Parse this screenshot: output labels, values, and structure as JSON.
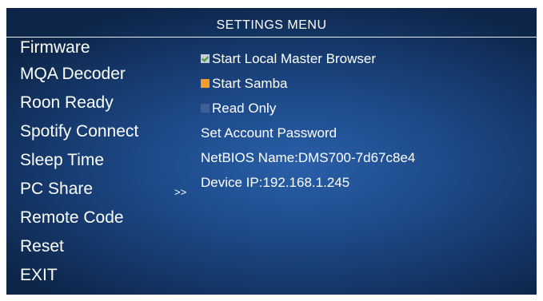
{
  "header": {
    "title": "SETTINGS MENU"
  },
  "menu": {
    "items": [
      {
        "label": "Firmware"
      },
      {
        "label": "MQA Decoder"
      },
      {
        "label": "Roon Ready"
      },
      {
        "label": "Spotify Connect"
      },
      {
        "label": "Sleep Time"
      },
      {
        "label": "PC Share"
      },
      {
        "label": "Remote Code"
      },
      {
        "label": "Reset"
      },
      {
        "label": "EXIT"
      }
    ],
    "selected_indicator": ">>"
  },
  "panel": {
    "options": [
      {
        "label": "Start Local Master Browser",
        "state": "checked"
      },
      {
        "label": "Start Samba",
        "state": "focused"
      },
      {
        "label": "Read Only",
        "state": "unchecked"
      }
    ],
    "set_password": "Set Account Password",
    "netbios": "NetBIOS Name:DMS700-7d67c8e4",
    "device_ip": "Device IP:192.168.1.245"
  },
  "colors": {
    "background": "#1d4a8a",
    "focus": "#f39b2b",
    "check": "#3a9a3a"
  }
}
